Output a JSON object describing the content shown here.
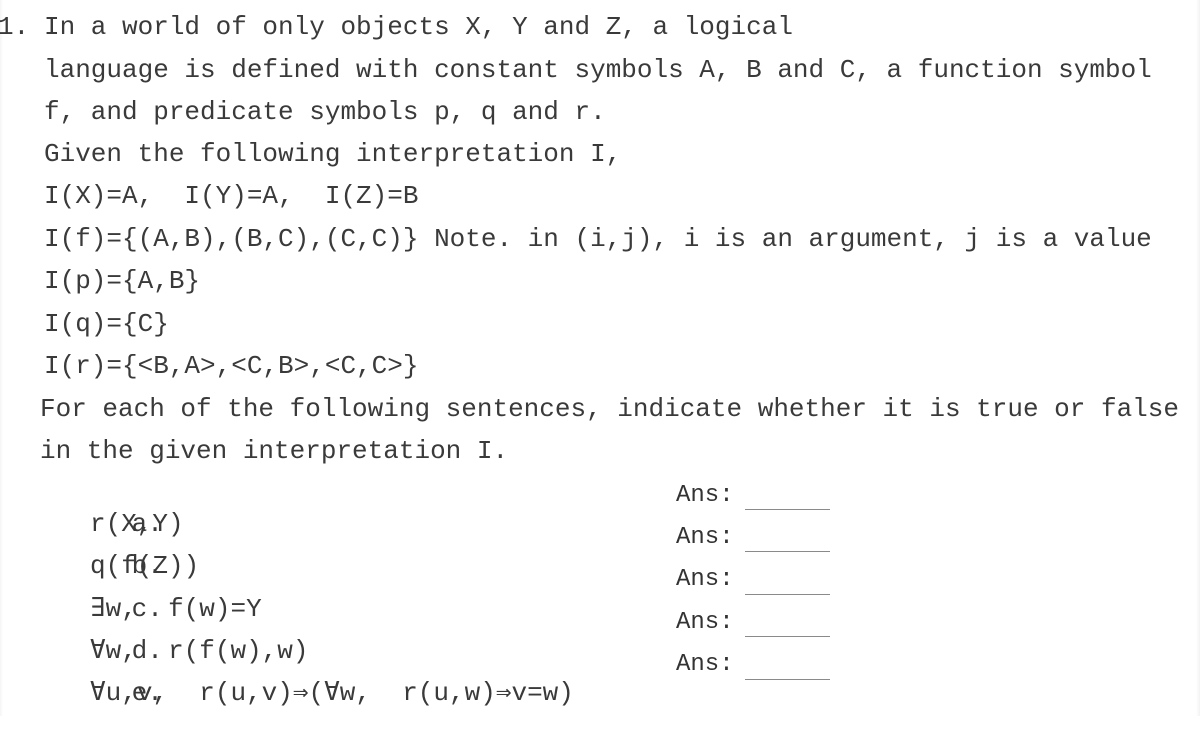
{
  "question": {
    "number": "1.",
    "intro_lines": [
      "In a world of only objects X, Y and Z, a logical",
      "language is defined with constant symbols A, B and C, a function symbol",
      "f, and predicate symbols p, q and r."
    ],
    "given_line": "Given the following interpretation I,",
    "interpretation": [
      "I(X)=A,  I(Y)=A,  I(Z)=B",
      "I(f)={(A,B),(B,C),(C,C)} Note. in (i,j), i is an argument, j is a value",
      "I(p)={A,B}",
      "I(q)={C}",
      "I(r)={<B,A>,<C,B>,<C,C>}"
    ],
    "instruction_lines": [
      "For each of the following sentences, indicate whether it is true or false",
      "in the given interpretation I."
    ],
    "items": [
      {
        "label": "a.",
        "formula": "r(X,Y)",
        "answer_label": "Ans:",
        "answer_value": ""
      },
      {
        "label": "b.",
        "formula": "q(f(Z))",
        "answer_label": "Ans:",
        "answer_value": ""
      },
      {
        "label": "c.",
        "formula": "∃w,  f(w)=Y",
        "answer_label": "Ans:",
        "answer_value": ""
      },
      {
        "label": "d.",
        "formula": "∀w,  r(f(w),w)",
        "answer_label": "Ans:",
        "answer_value": ""
      },
      {
        "label": "e.",
        "formula": "∀u,v,  r(u,v)⇒(∀w,  r(u,w)⇒v=w)",
        "answer_label": "Ans:",
        "answer_value": ""
      }
    ]
  }
}
